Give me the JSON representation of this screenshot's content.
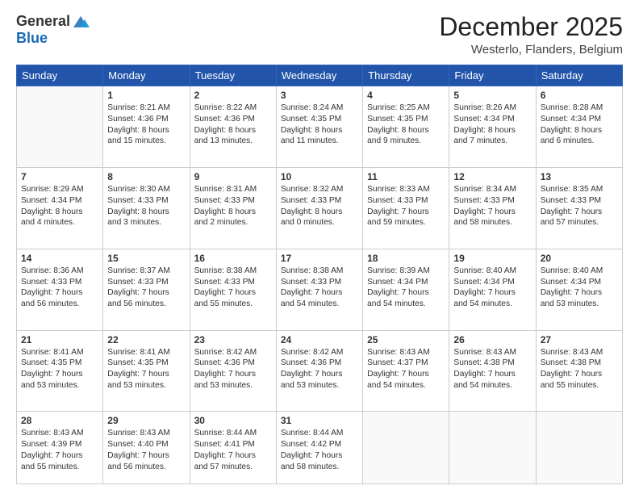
{
  "header": {
    "logo_general": "General",
    "logo_blue": "Blue",
    "month_title": "December 2025",
    "location": "Westerlo, Flanders, Belgium"
  },
  "days_of_week": [
    "Sunday",
    "Monday",
    "Tuesday",
    "Wednesday",
    "Thursday",
    "Friday",
    "Saturday"
  ],
  "weeks": [
    [
      {
        "day": "",
        "info": ""
      },
      {
        "day": "1",
        "info": "Sunrise: 8:21 AM\nSunset: 4:36 PM\nDaylight: 8 hours\nand 15 minutes."
      },
      {
        "day": "2",
        "info": "Sunrise: 8:22 AM\nSunset: 4:36 PM\nDaylight: 8 hours\nand 13 minutes."
      },
      {
        "day": "3",
        "info": "Sunrise: 8:24 AM\nSunset: 4:35 PM\nDaylight: 8 hours\nand 11 minutes."
      },
      {
        "day": "4",
        "info": "Sunrise: 8:25 AM\nSunset: 4:35 PM\nDaylight: 8 hours\nand 9 minutes."
      },
      {
        "day": "5",
        "info": "Sunrise: 8:26 AM\nSunset: 4:34 PM\nDaylight: 8 hours\nand 7 minutes."
      },
      {
        "day": "6",
        "info": "Sunrise: 8:28 AM\nSunset: 4:34 PM\nDaylight: 8 hours\nand 6 minutes."
      }
    ],
    [
      {
        "day": "7",
        "info": "Sunrise: 8:29 AM\nSunset: 4:34 PM\nDaylight: 8 hours\nand 4 minutes."
      },
      {
        "day": "8",
        "info": "Sunrise: 8:30 AM\nSunset: 4:33 PM\nDaylight: 8 hours\nand 3 minutes."
      },
      {
        "day": "9",
        "info": "Sunrise: 8:31 AM\nSunset: 4:33 PM\nDaylight: 8 hours\nand 2 minutes."
      },
      {
        "day": "10",
        "info": "Sunrise: 8:32 AM\nSunset: 4:33 PM\nDaylight: 8 hours\nand 0 minutes."
      },
      {
        "day": "11",
        "info": "Sunrise: 8:33 AM\nSunset: 4:33 PM\nDaylight: 7 hours\nand 59 minutes."
      },
      {
        "day": "12",
        "info": "Sunrise: 8:34 AM\nSunset: 4:33 PM\nDaylight: 7 hours\nand 58 minutes."
      },
      {
        "day": "13",
        "info": "Sunrise: 8:35 AM\nSunset: 4:33 PM\nDaylight: 7 hours\nand 57 minutes."
      }
    ],
    [
      {
        "day": "14",
        "info": "Sunrise: 8:36 AM\nSunset: 4:33 PM\nDaylight: 7 hours\nand 56 minutes."
      },
      {
        "day": "15",
        "info": "Sunrise: 8:37 AM\nSunset: 4:33 PM\nDaylight: 7 hours\nand 56 minutes."
      },
      {
        "day": "16",
        "info": "Sunrise: 8:38 AM\nSunset: 4:33 PM\nDaylight: 7 hours\nand 55 minutes."
      },
      {
        "day": "17",
        "info": "Sunrise: 8:38 AM\nSunset: 4:33 PM\nDaylight: 7 hours\nand 54 minutes."
      },
      {
        "day": "18",
        "info": "Sunrise: 8:39 AM\nSunset: 4:34 PM\nDaylight: 7 hours\nand 54 minutes."
      },
      {
        "day": "19",
        "info": "Sunrise: 8:40 AM\nSunset: 4:34 PM\nDaylight: 7 hours\nand 54 minutes."
      },
      {
        "day": "20",
        "info": "Sunrise: 8:40 AM\nSunset: 4:34 PM\nDaylight: 7 hours\nand 53 minutes."
      }
    ],
    [
      {
        "day": "21",
        "info": "Sunrise: 8:41 AM\nSunset: 4:35 PM\nDaylight: 7 hours\nand 53 minutes."
      },
      {
        "day": "22",
        "info": "Sunrise: 8:41 AM\nSunset: 4:35 PM\nDaylight: 7 hours\nand 53 minutes."
      },
      {
        "day": "23",
        "info": "Sunrise: 8:42 AM\nSunset: 4:36 PM\nDaylight: 7 hours\nand 53 minutes."
      },
      {
        "day": "24",
        "info": "Sunrise: 8:42 AM\nSunset: 4:36 PM\nDaylight: 7 hours\nand 53 minutes."
      },
      {
        "day": "25",
        "info": "Sunrise: 8:43 AM\nSunset: 4:37 PM\nDaylight: 7 hours\nand 54 minutes."
      },
      {
        "day": "26",
        "info": "Sunrise: 8:43 AM\nSunset: 4:38 PM\nDaylight: 7 hours\nand 54 minutes."
      },
      {
        "day": "27",
        "info": "Sunrise: 8:43 AM\nSunset: 4:38 PM\nDaylight: 7 hours\nand 55 minutes."
      }
    ],
    [
      {
        "day": "28",
        "info": "Sunrise: 8:43 AM\nSunset: 4:39 PM\nDaylight: 7 hours\nand 55 minutes."
      },
      {
        "day": "29",
        "info": "Sunrise: 8:43 AM\nSunset: 4:40 PM\nDaylight: 7 hours\nand 56 minutes."
      },
      {
        "day": "30",
        "info": "Sunrise: 8:44 AM\nSunset: 4:41 PM\nDaylight: 7 hours\nand 57 minutes."
      },
      {
        "day": "31",
        "info": "Sunrise: 8:44 AM\nSunset: 4:42 PM\nDaylight: 7 hours\nand 58 minutes."
      },
      {
        "day": "",
        "info": ""
      },
      {
        "day": "",
        "info": ""
      },
      {
        "day": "",
        "info": ""
      }
    ]
  ]
}
